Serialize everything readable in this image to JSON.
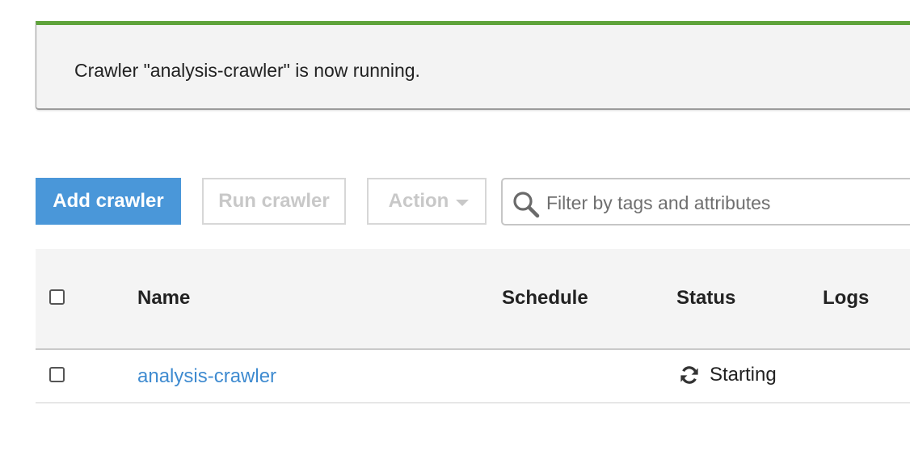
{
  "flash": {
    "message": "Crawler \"analysis-crawler\" is now running.",
    "accent_color": "#5ea33a"
  },
  "toolbar": {
    "add_label": "Add crawler",
    "run_label": "Run crawler",
    "action_label": "Action",
    "search_placeholder": "Filter by tags and attributes",
    "search_value": ""
  },
  "table": {
    "columns": [
      "Name",
      "Schedule",
      "Status",
      "Logs"
    ],
    "rows": [
      {
        "name": "analysis-crawler",
        "schedule": "",
        "status": "Starting",
        "status_icon": "refresh-icon",
        "logs": ""
      }
    ]
  },
  "colors": {
    "primary": "#4a97d9",
    "link": "#3f8bd0",
    "disabled": "#c8c8c8"
  }
}
